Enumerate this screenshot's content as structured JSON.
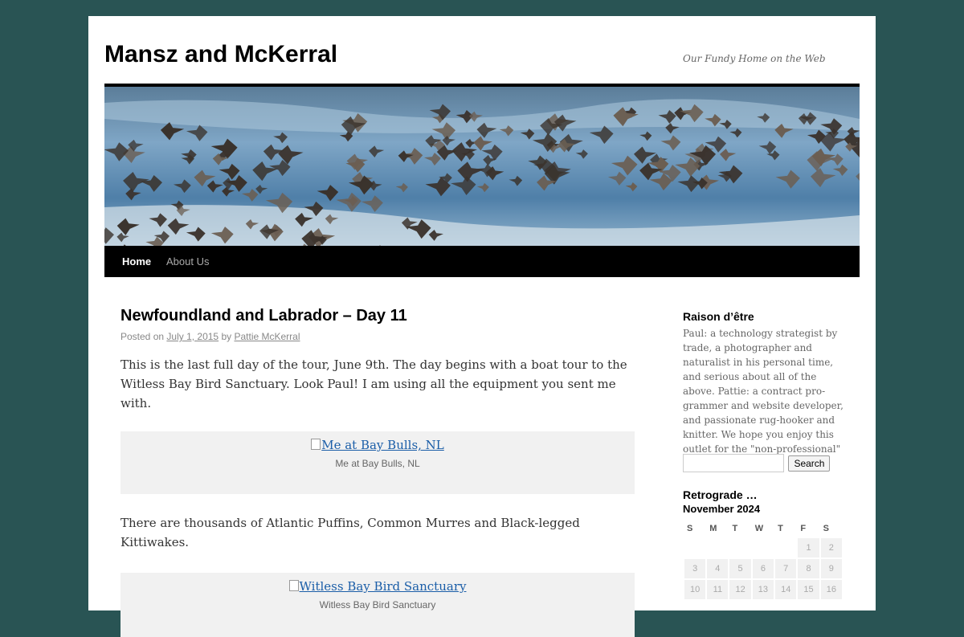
{
  "site": {
    "title": "Mansz and McKerral",
    "description": "Our Fundy Home on the Web"
  },
  "nav": {
    "items": [
      {
        "label": "Home",
        "current": true
      },
      {
        "label": "About Us",
        "current": false
      }
    ]
  },
  "post": {
    "title": "Newfoundland and Labrador – Day 11",
    "meta_posted_on": "Posted on",
    "meta_date": "July 1, 2015",
    "meta_by": "by",
    "meta_author": "Pattie McKerral",
    "paragraph1": "This is the last full day of the tour, June 9th. The day begins with a boat tour to the Witless Bay Bird Sanctuary. Look Paul! I am using all the equipment you sent me with.",
    "image1_alt": "Me at Bay Bulls, NL",
    "image1_caption": "Me at Bay Bulls, NL",
    "paragraph2": "There are thousands of Atlantic Puffins, Common Murres and Black-legged Kittiwakes.",
    "image2_alt": "Witless Bay Bird Sanctuary",
    "image2_caption": "Witless Bay Bird Sanctuary"
  },
  "sidebar": {
    "about_title": "Raison d’être",
    "about_text": "Paul: a technology strategist by trade, a photographer and naturalist in his personal time, and serious about all of the above. Pattie: a contract pro­grammer and website developer, and passionate rug-hooker and knitter. We hope you enjoy this outlet for the \"non-professional\" Pattie and me.",
    "search_placeholder": "",
    "search_button": "Search",
    "calendar_title": "Retrograde …",
    "calendar_month": "November 2024",
    "calendar_days": [
      "S",
      "M",
      "T",
      "W",
      "T",
      "F",
      "S"
    ],
    "calendar_rows": [
      [
        "",
        "",
        "",
        "",
        "",
        "1",
        "2"
      ],
      [
        "3",
        "4",
        "5",
        "6",
        "7",
        "8",
        "9"
      ],
      [
        "10",
        "11",
        "12",
        "13",
        "14",
        "15",
        "16"
      ]
    ]
  },
  "colors": {
    "page_background": "#295454",
    "link": "#1b5ea8",
    "nav_background": "#000000"
  }
}
